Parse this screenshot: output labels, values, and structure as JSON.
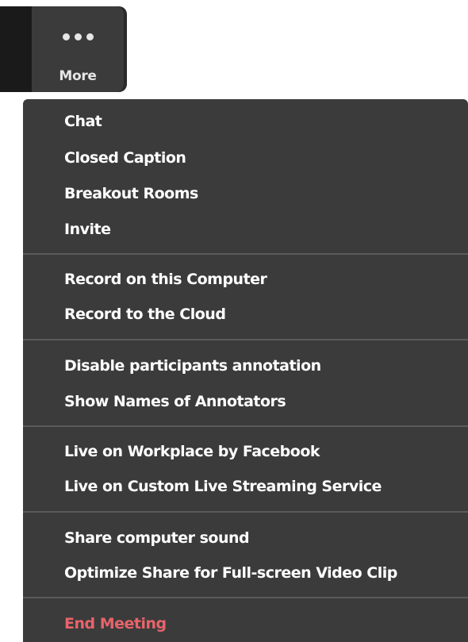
{
  "toolbar": {
    "more_label": "More",
    "more_icon": "ellipsis-icon"
  },
  "menu": {
    "groups": [
      {
        "items": [
          {
            "label": "Chat"
          },
          {
            "label": "Closed Caption"
          },
          {
            "label": "Breakout Rooms"
          },
          {
            "label": "Invite"
          }
        ]
      },
      {
        "items": [
          {
            "label": "Record on this Computer"
          },
          {
            "label": "Record to the Cloud"
          }
        ]
      },
      {
        "items": [
          {
            "label": "Disable participants annotation"
          },
          {
            "label": "Show Names of Annotators"
          }
        ]
      },
      {
        "items": [
          {
            "label": "Live on Workplace by Facebook"
          },
          {
            "label": "Live on Custom Live Streaming Service"
          }
        ]
      },
      {
        "items": [
          {
            "label": "Share computer sound"
          },
          {
            "label": "Optimize Share for Full-screen Video Clip"
          }
        ]
      },
      {
        "items": [
          {
            "label": "End Meeting"
          }
        ]
      }
    ]
  },
  "colors": {
    "menu_bg": "#3b3b3b",
    "text": "#ffffff",
    "end_meeting": "#e8646b",
    "divider": "#5a5a5a"
  }
}
